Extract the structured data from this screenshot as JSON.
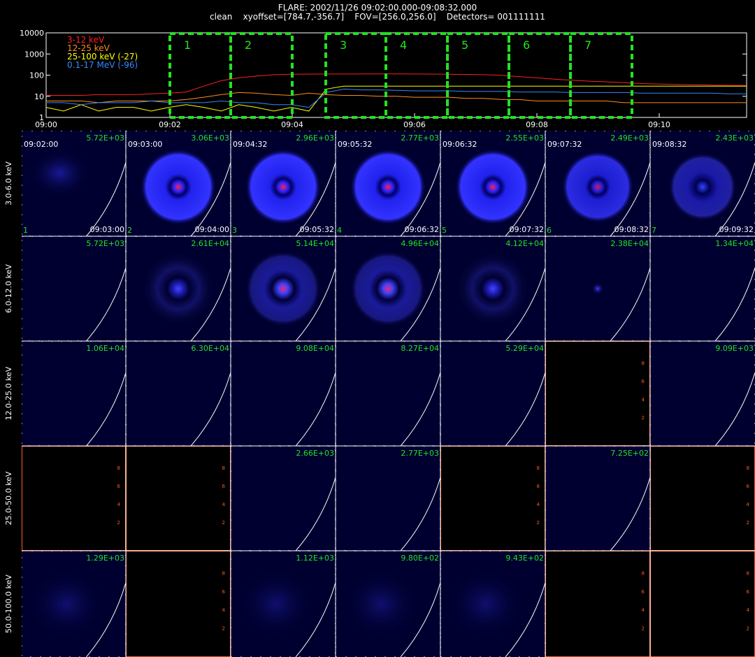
{
  "header": {
    "title": "FLARE: 2002/11/26 09:02:00.000-09:08:32.000",
    "subtitle": "clean    xyoffset=[784.7,-356.7]    FOV=[256.0,256.0]    Detectors= 001111111"
  },
  "chart_data": [
    {
      "type": "line",
      "ylog": true,
      "yticks": [
        "10000",
        "1000",
        "100",
        "10",
        "1"
      ],
      "xticks": [
        "09:00",
        "09:02",
        "09:04",
        "09:06",
        "09:08",
        "09:10"
      ],
      "legend_placement": "top-left",
      "series": [
        {
          "name": "3-12 keV",
          "color": "#ff2020",
          "values": [
            11,
            11,
            11,
            12,
            12,
            12,
            13,
            14,
            16,
            30,
            55,
            75,
            90,
            105,
            110,
            112,
            113,
            113,
            114,
            114,
            114,
            113,
            112,
            110,
            108,
            105,
            98,
            85,
            75,
            65,
            58,
            52,
            48,
            44,
            40,
            38,
            36,
            35,
            34,
            33,
            33
          ]
        },
        {
          "name": "12-25 keV",
          "color": "#ff8c1a",
          "values": [
            6,
            6,
            6,
            5,
            6,
            6,
            6,
            6,
            7,
            9,
            12,
            15,
            14,
            12,
            11,
            14,
            12,
            11,
            11,
            10,
            10,
            9,
            9,
            9,
            8,
            8,
            7,
            7,
            6,
            6,
            6,
            6,
            6,
            5,
            5,
            5,
            5,
            5,
            5,
            5,
            5
          ]
        },
        {
          "name": "25-100 keV (-27)",
          "color": "#ffff00",
          "values": [
            3,
            2,
            4,
            2,
            3,
            3,
            2,
            3,
            4,
            3,
            2,
            4,
            3,
            2,
            3,
            2,
            22,
            30,
            30,
            30,
            30,
            30,
            30,
            30,
            30,
            30,
            30,
            30,
            30,
            30,
            30,
            30,
            30,
            30,
            30,
            30,
            30,
            30,
            30,
            30,
            30
          ]
        },
        {
          "name": "0.1-17 MeV (-96)",
          "color": "#3388ff",
          "values": [
            5,
            5,
            4,
            5,
            5,
            5,
            6,
            5,
            5,
            5,
            6,
            5,
            5,
            4,
            4,
            3,
            15,
            22,
            20,
            20,
            19,
            18,
            18,
            18,
            17,
            17,
            17,
            16,
            16,
            16,
            15,
            15,
            15,
            15,
            14,
            14,
            14,
            14,
            14,
            13,
            13
          ]
        }
      ],
      "intervals": [
        "1",
        "2",
        "3",
        "4",
        "5",
        "6",
        "7"
      ]
    },
    {
      "type": "heatmap",
      "row_labels": [
        "3.0-6.0 keV",
        "6.0-12.0 keV",
        "12.0-25.0 keV",
        "25.0-50.0 keV",
        "50.0-100.0 keV"
      ],
      "start_times": [
        "09:02:00",
        "09:03:00",
        "09:04:32",
        "09:05:32",
        "09:06:32",
        "09:07:32",
        "09:08:32"
      ],
      "end_times": [
        "09:03:00",
        "09:04:00",
        "09:05:32",
        "09:06:32",
        "09:07:32",
        "09:08:32",
        "09:09:32"
      ],
      "intervals": [
        "1",
        "2",
        "3",
        "4",
        "5",
        "6",
        "7"
      ],
      "rows": [
        [
          {
            "v": "5.72E+03",
            "k": "blob"
          },
          {
            "v": "3.06E+03",
            "k": "ring"
          },
          {
            "v": "2.96E+03",
            "k": "ring"
          },
          {
            "v": "2.77E+03",
            "k": "ring"
          },
          {
            "v": "2.55E+03",
            "k": "ring"
          },
          {
            "v": "2.49E+03",
            "k": "ring2"
          },
          {
            "v": "2.43E+03",
            "k": "ring3"
          }
        ],
        [
          {
            "v": "5.72E+03",
            "k": "dark"
          },
          {
            "v": "2.61E+04",
            "k": "faint"
          },
          {
            "v": "5.14E+04",
            "k": "mid"
          },
          {
            "v": "4.96E+04",
            "k": "mid"
          },
          {
            "v": "4.12E+04",
            "k": "faint"
          },
          {
            "v": "2.38E+04",
            "k": "dot"
          },
          {
            "v": "1.34E+04",
            "k": "dark"
          }
        ],
        [
          {
            "v": "1.06E+04",
            "k": "dark"
          },
          {
            "v": "6.30E+04",
            "k": "dark"
          },
          {
            "v": "9.08E+04",
            "k": "dark"
          },
          {
            "v": "8.27E+04",
            "k": "dark"
          },
          {
            "v": "5.29E+04",
            "k": "dark"
          },
          {
            "v": "",
            "k": "empty"
          },
          {
            "v": "9.09E+03",
            "k": "dark"
          }
        ],
        [
          {
            "v": "",
            "k": "empty"
          },
          {
            "v": "",
            "k": "empty"
          },
          {
            "v": "2.66E+03",
            "k": "dark"
          },
          {
            "v": "2.77E+03",
            "k": "dark"
          },
          {
            "v": "",
            "k": "empty"
          },
          {
            "v": "7.25E+02",
            "k": "dark"
          },
          {
            "v": "",
            "k": "empty"
          }
        ],
        [
          {
            "v": "1.29E+03",
            "k": "noise"
          },
          {
            "v": "",
            "k": "empty"
          },
          {
            "v": "1.12E+03",
            "k": "noise"
          },
          {
            "v": "9.80E+02",
            "k": "noise"
          },
          {
            "v": "9.43E+02",
            "k": "noise"
          },
          {
            "v": "",
            "k": "empty"
          },
          {
            "v": "",
            "k": "empty"
          }
        ]
      ],
      "empty_axis_ticks": [
        "2",
        "4",
        "6",
        "8"
      ]
    }
  ]
}
